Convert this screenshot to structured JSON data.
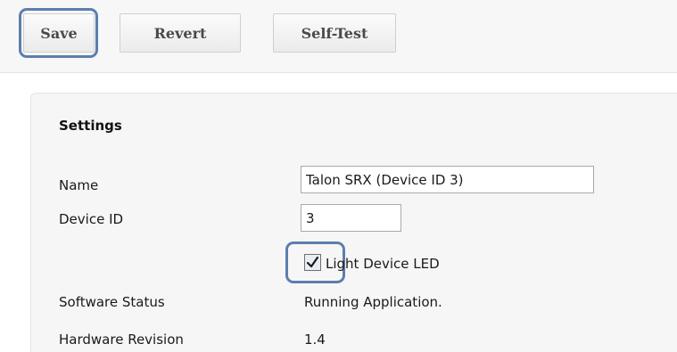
{
  "toolbar": {
    "save_label": "Save",
    "revert_label": "Revert",
    "self_test_label": "Self-Test"
  },
  "settings": {
    "title": "Settings",
    "name_label": "Name",
    "name_value": "Talon SRX (Device ID 3)",
    "device_id_label": "Device ID",
    "device_id_value": "3",
    "led_checkbox_label": "Light Device LED",
    "led_checked": true,
    "software_status_label": "Software Status",
    "software_status_value": "Running Application.",
    "hardware_revision_label": "Hardware Revision",
    "hardware_revision_value": "1.4"
  },
  "colors": {
    "focus_ring": "#5b7fae",
    "toolbar_bg": "#f7f7f7",
    "panel_bg": "#f6f6f6"
  }
}
